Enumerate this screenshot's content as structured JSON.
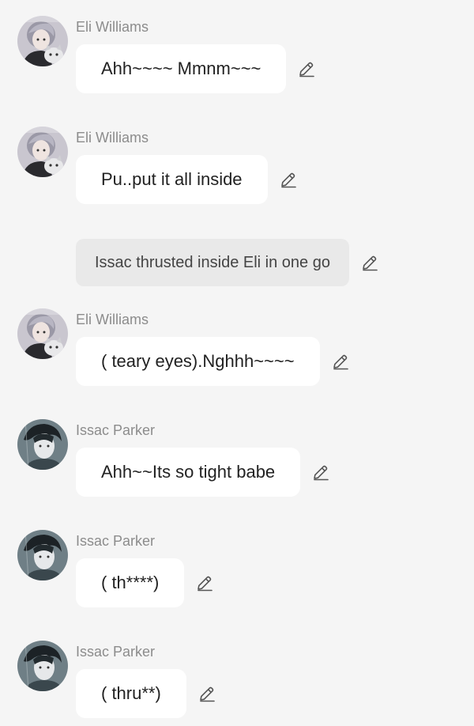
{
  "messages": [
    {
      "type": "char",
      "name": "Eli Williams",
      "text": "Ahh~~~~ Mmnm~~~",
      "avatar": "eli-avatar",
      "edit_icon": "pencil-icon"
    },
    {
      "type": "char",
      "name": "Eli Williams",
      "text": "Pu..put it all inside",
      "avatar": "eli-avatar",
      "edit_icon": "pencil-icon"
    },
    {
      "type": "narration",
      "text": "Issac thrusted inside Eli in one go",
      "edit_icon": "pencil-icon"
    },
    {
      "type": "char",
      "name": "Eli Williams",
      "text": "( teary eyes).Nghhh~~~~",
      "avatar": "eli-avatar",
      "edit_icon": "pencil-icon"
    },
    {
      "type": "char",
      "name": "Issac Parker",
      "text": "Ahh~~Its so tight  babe",
      "avatar": "issac-avatar",
      "edit_icon": "pencil-icon"
    },
    {
      "type": "char",
      "name": "Issac Parker",
      "text": "( th****)",
      "avatar": "issac-avatar",
      "edit_icon": "pencil-icon"
    },
    {
      "type": "char",
      "name": "Issac Parker",
      "text": "( thru**)",
      "avatar": "issac-avatar",
      "edit_icon": "pencil-icon"
    }
  ],
  "colors": {
    "background": "#f5f5f5",
    "bubble": "#ffffff",
    "narration_bubble": "#e9e9e9",
    "name_text": "#8c8c8c",
    "message_text": "#222222"
  }
}
